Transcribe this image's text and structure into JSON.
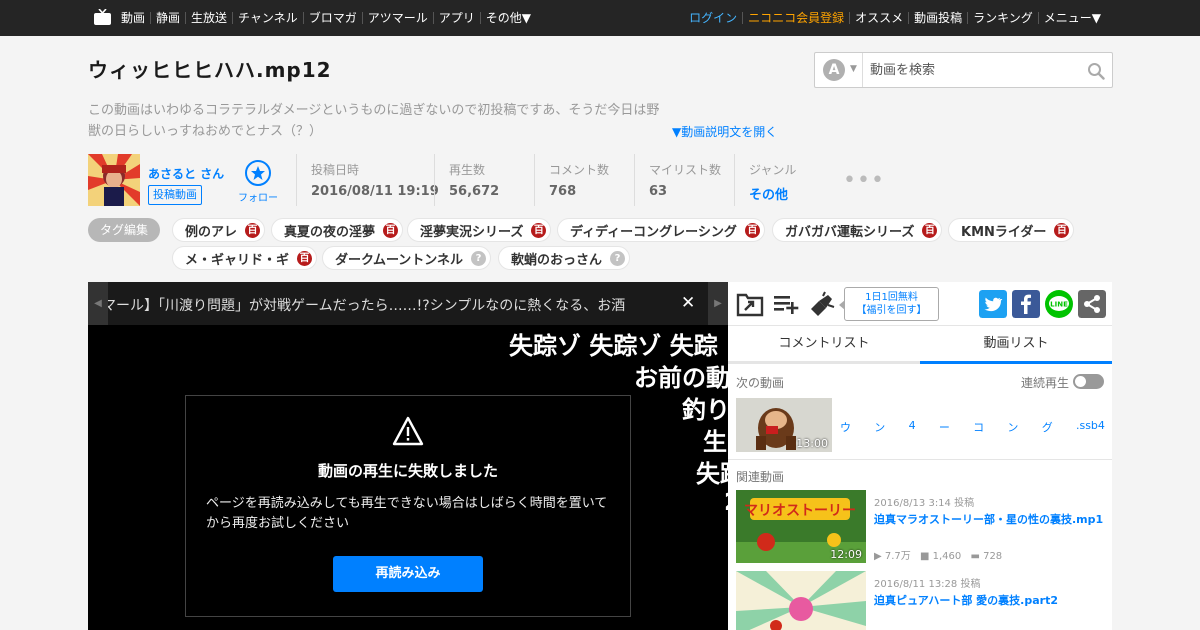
{
  "nav": {
    "left": [
      "動画",
      "静画",
      "生放送",
      "チャンネル",
      "ブロマガ",
      "アツマール",
      "アプリ",
      "その他▼"
    ],
    "right": {
      "login": "ログイン",
      "premium": "ニコニコ会員登録",
      "items": [
        "オススメ",
        "動画投稿",
        "ランキング",
        "メニュー▼"
      ]
    }
  },
  "video": {
    "title": "ウィッヒヒヒハハ.mp12",
    "description": "この動画はいわゆるコラテラルダメージというものに過ぎないので初投稿ですあ、そうだ今日は野獣の日らしいっすねおめでとナス（？）",
    "open_description": "▼動画説明文を開く"
  },
  "search": {
    "placeholder": "動画を検索",
    "type_letter": "A"
  },
  "uploader": {
    "name": "あさると さん",
    "videos_label": "投稿動画",
    "follow_label": "フォロー"
  },
  "stats": [
    {
      "label": "投稿日時",
      "value": "2016/08/11 19:19"
    },
    {
      "label": "再生数",
      "value": "56,672"
    },
    {
      "label": "コメント数",
      "value": "768"
    },
    {
      "label": "マイリスト数",
      "value": "63"
    },
    {
      "label": "ジャンル",
      "value": "その他"
    }
  ],
  "tags": {
    "edit_label": "タグ編集",
    "items": [
      {
        "label": "例のアレ",
        "badge": "百",
        "locked": true
      },
      {
        "label": "真夏の夜の淫夢",
        "badge": "百",
        "locked": true
      },
      {
        "label": "淫夢実況シリーズ",
        "badge": "百",
        "locked": true
      },
      {
        "label": "ディディーコングレーシング",
        "badge": "百",
        "locked": true
      },
      {
        "label": "ガバガバ運転シリーズ",
        "badge": "百",
        "locked": true
      },
      {
        "label": "KMNライダー",
        "badge": "百",
        "locked": true
      },
      {
        "label": "メ・ギャリド・ギ",
        "badge": "百",
        "locked": true
      },
      {
        "label": "ダークムーントンネル",
        "badge": "?",
        "locked": false
      },
      {
        "label": "軟蛸のおっさん",
        "badge": "?",
        "locked": false
      }
    ]
  },
  "player": {
    "ticker": "マール】「川渡り問題」が対戦ゲームだったら……!?シンプルなのに熱くなる、お酒",
    "comments": [
      "失踪ゾ 失踪ゾ 失踪",
      "お前の動",
      "釣り",
      "生",
      "失踪",
      "2"
    ],
    "error_title": "動画の再生に失敗しました",
    "error_message": "ページを再読み込みしても再生できない場合はしばらく時間を置いてから再度お試しください",
    "reload_label": "再読み込み"
  },
  "side": {
    "free_bubble": [
      "1日1回無料",
      "【福引を回す】"
    ],
    "tabs": [
      "コメントリスト",
      "動画リスト"
    ],
    "next_label": "次の動画",
    "autoplay_label": "連続再生",
    "autoplay_on": false,
    "next_video": {
      "title_chars": [
        "ウ",
        "ン",
        "4",
        "ー",
        "コ",
        "ン",
        "グ",
        ".ssb4"
      ],
      "duration": "13:00"
    },
    "related_label": "関連動画",
    "related": [
      {
        "date": "2016/8/13 3:14 投稿",
        "title": "迫真マラオストーリー部・星の性の裏技.mp1",
        "duration": "12:09",
        "views": "7.7万",
        "comments": "1,460",
        "mylists": "728"
      },
      {
        "date": "2016/8/11 13:28 投稿",
        "title": "迫真ピュアハート部 愛の裏技.part2"
      }
    ]
  },
  "colors": {
    "accent": "#0080ff",
    "topbar": "#252525",
    "premium": "#ffa400",
    "login": "#45b5ff",
    "lock_badge": "#b61b1b"
  }
}
